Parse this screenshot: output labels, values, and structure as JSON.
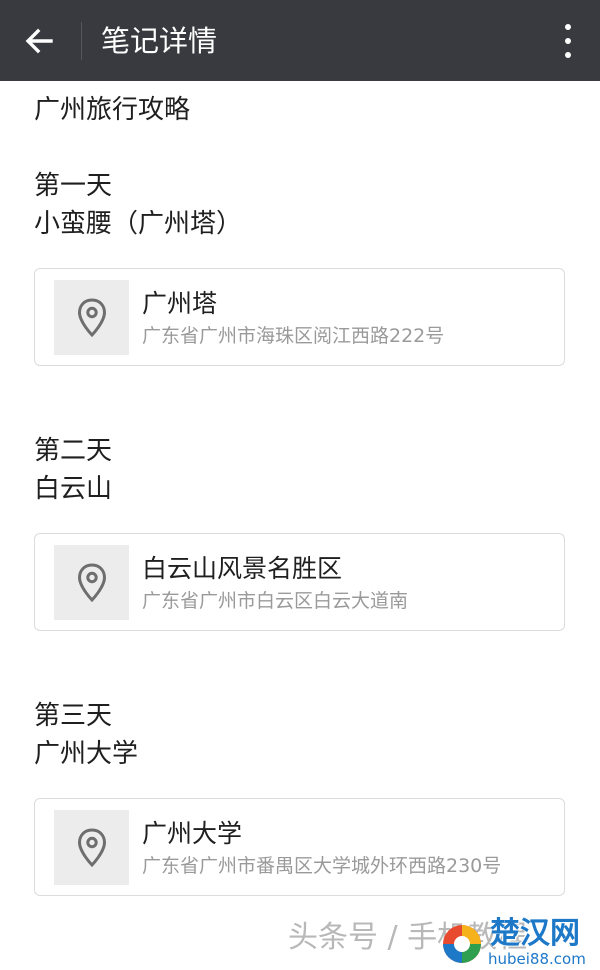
{
  "header": {
    "title": "笔记详情",
    "back_icon": "arrow-left-icon",
    "more_icon": "more-vertical-icon",
    "background": "#393a3f"
  },
  "note": {
    "title": "广州旅行攻略",
    "days": [
      {
        "label": "第一天",
        "spot": "小蛮腰（广州塔）",
        "location": {
          "name": "广州塔",
          "address": "广东省广州市海珠区阅江西路222号",
          "icon": "location-pin-icon"
        }
      },
      {
        "label": "第二天",
        "spot": "白云山",
        "location": {
          "name": "白云山风景名胜区",
          "address": "广东省广州市白云区白云大道南",
          "icon": "location-pin-icon"
        }
      },
      {
        "label": "第三天",
        "spot": "广州大学",
        "location": {
          "name": "广州大学",
          "address": "广东省广州市番禺区大学城外环西路230号",
          "icon": "location-pin-icon"
        }
      }
    ]
  },
  "watermark": {
    "text": "头条号 / 手机教程",
    "logo_cn": "楚汉网",
    "logo_en": "hubei88.com"
  }
}
